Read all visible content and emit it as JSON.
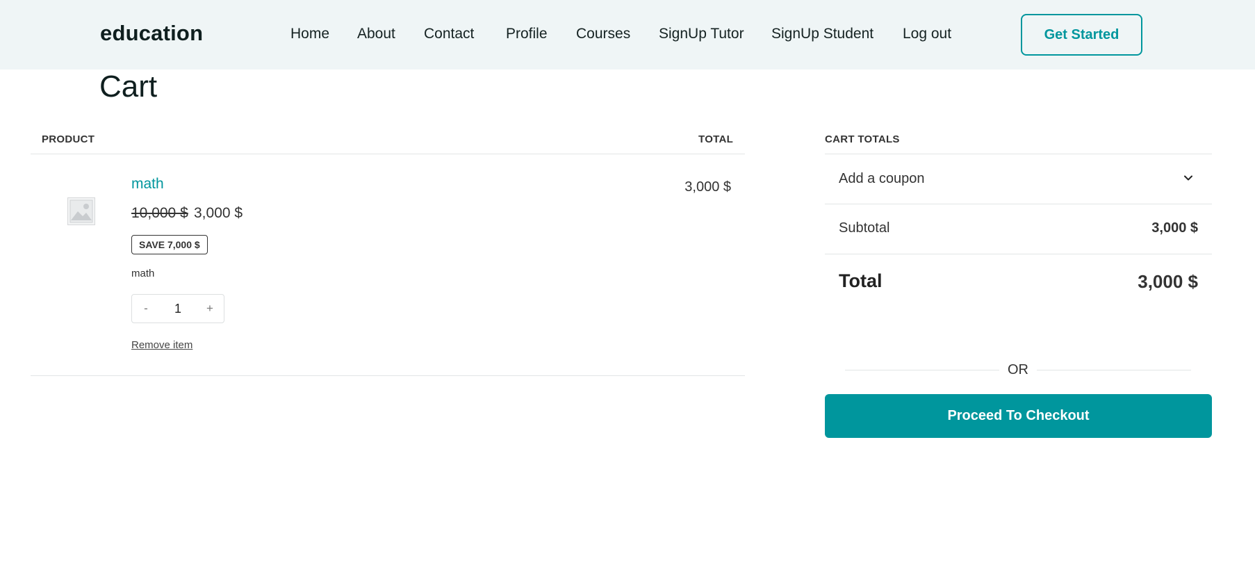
{
  "header": {
    "logo": "education",
    "nav": [
      "Home",
      "About",
      "Contact",
      "Profile",
      "Courses",
      "SignUp Tutor",
      "SignUp Student",
      "Log out"
    ],
    "cta_label": "Get Started"
  },
  "page": {
    "title": "Cart"
  },
  "cart": {
    "columns": {
      "product": "PRODUCT",
      "total": "TOTAL"
    },
    "item": {
      "name": "math",
      "regular_price": "10,000 $",
      "sale_price": "3,000 $",
      "save_badge": "SAVE 7,000 $",
      "meta": "math",
      "quantity": "1",
      "decrement": "-",
      "increment": "+",
      "remove_label": "Remove item",
      "line_total": "3,000 $",
      "thumbnail": "image-placeholder-icon"
    }
  },
  "totals": {
    "heading": "CART TOTALS",
    "coupon_label": "Add a coupon",
    "subtotal_label": "Subtotal",
    "subtotal_value": "3,000 $",
    "total_label": "Total",
    "total_value": "3,000 $",
    "or_label": "OR",
    "checkout_label": "Proceed To Checkout"
  },
  "colors": {
    "accent": "#00969d",
    "header_bg": "#eff5f6"
  }
}
